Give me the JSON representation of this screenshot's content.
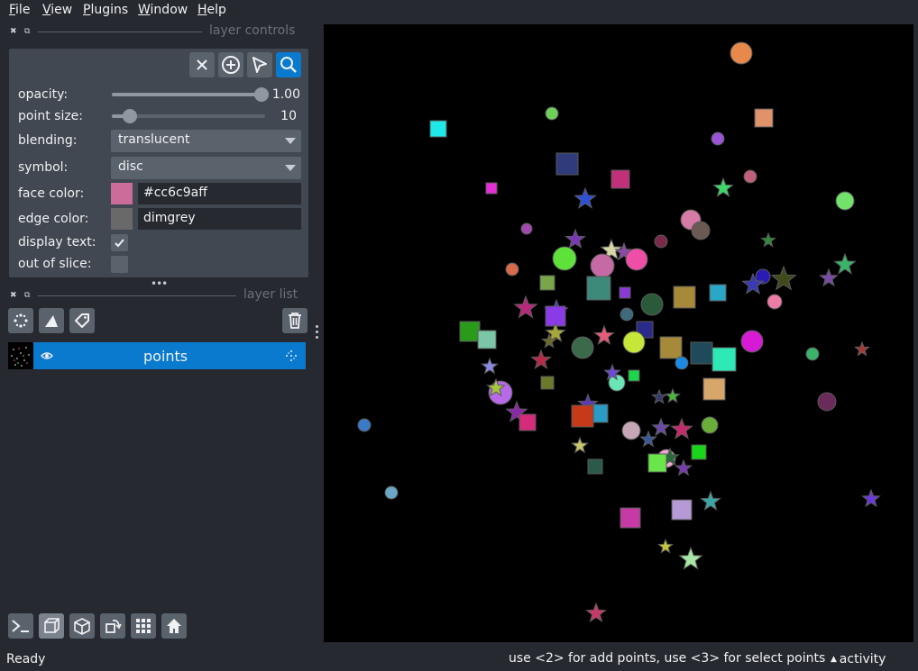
{
  "menubar": {
    "items": [
      {
        "label": "File",
        "ul": "F",
        "rest": "ile"
      },
      {
        "label": "View",
        "ul": "V",
        "rest": "iew"
      },
      {
        "label": "Plugins",
        "ul": "P",
        "rest": "lugins"
      },
      {
        "label": "Window",
        "ul": "W",
        "rest": "indow"
      },
      {
        "label": "Help",
        "ul": "H",
        "rest": "elp"
      }
    ]
  },
  "layer_controls": {
    "title": "layer controls",
    "opacity": {
      "label": "opacity:",
      "value": "1.00",
      "fraction": 1.0
    },
    "point_size": {
      "label": "point size:",
      "value": "10",
      "fraction": 0.12
    },
    "blending": {
      "label": "blending:",
      "value": "translucent"
    },
    "symbol": {
      "label": "symbol:",
      "value": "disc"
    },
    "face_color": {
      "label": "face color:",
      "value": "#cc6c9aff",
      "swatch": "#cc6c9a"
    },
    "edge_color": {
      "label": "edge color:",
      "value": "dimgrey",
      "swatch": "#696969"
    },
    "display_text": {
      "label": "display text:",
      "checked": true
    },
    "out_of_slice": {
      "label": "out of slice:",
      "checked": false
    }
  },
  "layer_list": {
    "title": "layer list",
    "layers": [
      {
        "name": "points",
        "visible": true,
        "selected": true
      }
    ]
  },
  "status": {
    "left": "Ready",
    "hint": "use <2> for add points, use <3> for select points",
    "activity": "activity"
  },
  "colors": {
    "accent": "#0a7acf",
    "panel": "#414851",
    "background": "#262930"
  }
}
